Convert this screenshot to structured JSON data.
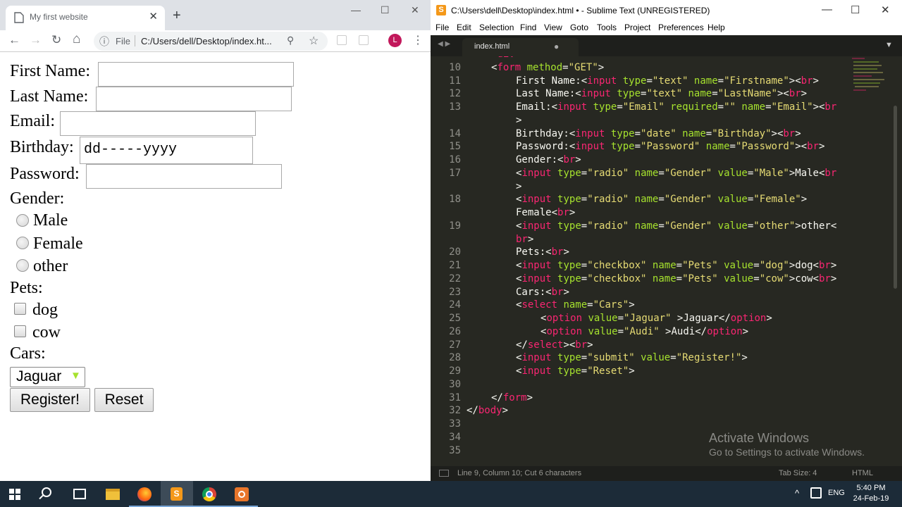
{
  "browser": {
    "tab_title": "My first website",
    "close_glyph": "✕",
    "newtab_glyph": "+",
    "window": {
      "min": "—",
      "max": "☐",
      "close": "✕"
    },
    "nav": {
      "back": "←",
      "forward": "→",
      "reload": "↻",
      "home": "⌂"
    },
    "omnibox": {
      "info": "ⓘ",
      "scheme_label": "File",
      "url": "C:/Users/dell/Desktop/index.ht...",
      "zoom": "⚲",
      "star": "☆"
    },
    "avatar_letter": "L",
    "menu": "⋮"
  },
  "form": {
    "first_name_label": "First Name:",
    "last_name_label": "Last Name:",
    "email_label": "Email:",
    "birthday_label": "Birthday:",
    "birthday_placeholder": "dd-----yyyy",
    "password_label": "Password:",
    "gender_label": "Gender:",
    "gender_options": [
      "Male",
      "Female",
      "other"
    ],
    "pets_label": "Pets:",
    "pet_options": [
      "dog",
      "cow"
    ],
    "cars_label": "Cars:",
    "cars_selected": "Jaguar",
    "cars_arrow": "▼",
    "register_label": "Register!",
    "reset_label": "Reset"
  },
  "sublime": {
    "title": "C:\\Users\\dell\\Desktop\\index.html • - Sublime Text (UNREGISTERED)",
    "icon_letter": "S",
    "window": {
      "min": "—",
      "max": "☐",
      "close": "✕"
    },
    "menu": [
      "File",
      "Edit",
      "Selection",
      "Find",
      "View",
      "Goto",
      "Tools",
      "Project",
      "Preferences",
      "Help"
    ],
    "tab_arrows": "◀ ▶",
    "tab_name": "index.html",
    "tab_dot": "●",
    "tab_dropdown": "▼",
    "lines": [
      {
        "n": "",
        "indent": 1,
        "parts": [
          [
            "<",
            ""
          ],
          [
            "div",
            "t"
          ],
          [
            ">",
            ""
          ]
        ]
      },
      {
        "n": "10",
        "indent": 1,
        "parts": [
          [
            "<",
            ""
          ],
          [
            "form",
            "t"
          ],
          [
            " ",
            ""
          ],
          [
            "method",
            "a"
          ],
          [
            "=",
            ""
          ],
          [
            "\"GET\"",
            "s"
          ],
          [
            ">",
            ""
          ]
        ]
      },
      {
        "n": "11",
        "indent": 2,
        "parts": [
          [
            "First Name:<",
            ""
          ],
          [
            "input",
            "t"
          ],
          [
            " ",
            ""
          ],
          [
            "type",
            "a"
          ],
          [
            "=",
            ""
          ],
          [
            "\"text\"",
            "s"
          ],
          [
            " ",
            ""
          ],
          [
            "name",
            "a"
          ],
          [
            "=",
            ""
          ],
          [
            "\"Firstname\"",
            "s"
          ],
          [
            "><",
            ""
          ],
          [
            "br",
            "t"
          ],
          [
            ">",
            ""
          ]
        ]
      },
      {
        "n": "12",
        "indent": 2,
        "parts": [
          [
            "Last Name:<",
            ""
          ],
          [
            "input",
            "t"
          ],
          [
            " ",
            ""
          ],
          [
            "type",
            "a"
          ],
          [
            "=",
            ""
          ],
          [
            "\"text\"",
            "s"
          ],
          [
            " ",
            ""
          ],
          [
            "name",
            "a"
          ],
          [
            "=",
            ""
          ],
          [
            "\"LastName\"",
            "s"
          ],
          [
            "><",
            ""
          ],
          [
            "br",
            "t"
          ],
          [
            ">",
            ""
          ]
        ]
      },
      {
        "n": "13",
        "indent": 2,
        "parts": [
          [
            "Email:<",
            ""
          ],
          [
            "input",
            "t"
          ],
          [
            " ",
            ""
          ],
          [
            "type",
            "a"
          ],
          [
            "=",
            ""
          ],
          [
            "\"Email\"",
            "s"
          ],
          [
            " ",
            ""
          ],
          [
            "required",
            "a"
          ],
          [
            "=",
            ""
          ],
          [
            "\"\"",
            "s"
          ],
          [
            " ",
            ""
          ],
          [
            "name",
            "a"
          ],
          [
            "=",
            ""
          ],
          [
            "\"Email\"",
            "s"
          ],
          [
            "><",
            ""
          ],
          [
            "br",
            "t"
          ]
        ]
      },
      {
        "n": "",
        "indent": 2,
        "parts": [
          [
            ">",
            ""
          ]
        ]
      },
      {
        "n": "14",
        "indent": 2,
        "parts": [
          [
            "Birthday:<",
            ""
          ],
          [
            "input",
            "t"
          ],
          [
            " ",
            ""
          ],
          [
            "type",
            "a"
          ],
          [
            "=",
            ""
          ],
          [
            "\"date\"",
            "s"
          ],
          [
            " ",
            ""
          ],
          [
            "name",
            "a"
          ],
          [
            "=",
            ""
          ],
          [
            "\"Birthday\"",
            "s"
          ],
          [
            "><",
            ""
          ],
          [
            "br",
            "t"
          ],
          [
            ">",
            ""
          ]
        ]
      },
      {
        "n": "15",
        "indent": 2,
        "parts": [
          [
            "Password:<",
            ""
          ],
          [
            "input",
            "t"
          ],
          [
            " ",
            ""
          ],
          [
            "type",
            "a"
          ],
          [
            "=",
            ""
          ],
          [
            "\"Password\"",
            "s"
          ],
          [
            " ",
            ""
          ],
          [
            "name",
            "a"
          ],
          [
            "=",
            ""
          ],
          [
            "\"Password\"",
            "s"
          ],
          [
            "><",
            ""
          ],
          [
            "br",
            "t"
          ],
          [
            ">",
            ""
          ]
        ]
      },
      {
        "n": "16",
        "indent": 2,
        "parts": [
          [
            "Gender:<",
            ""
          ],
          [
            "br",
            "t"
          ],
          [
            ">",
            ""
          ]
        ]
      },
      {
        "n": "17",
        "indent": 2,
        "parts": [
          [
            "<",
            ""
          ],
          [
            "input",
            "t"
          ],
          [
            " ",
            ""
          ],
          [
            "type",
            "a"
          ],
          [
            "=",
            ""
          ],
          [
            "\"radio\"",
            "s"
          ],
          [
            " ",
            ""
          ],
          [
            "name",
            "a"
          ],
          [
            "=",
            ""
          ],
          [
            "\"Gender\"",
            "s"
          ],
          [
            " ",
            ""
          ],
          [
            "value",
            "a"
          ],
          [
            "=",
            ""
          ],
          [
            "\"Male\"",
            "s"
          ],
          [
            ">Male<",
            ""
          ],
          [
            "br",
            "t"
          ]
        ]
      },
      {
        "n": "",
        "indent": 2,
        "parts": [
          [
            ">",
            ""
          ]
        ]
      },
      {
        "n": "18",
        "indent": 2,
        "parts": [
          [
            "<",
            ""
          ],
          [
            "input",
            "t"
          ],
          [
            " ",
            ""
          ],
          [
            "type",
            "a"
          ],
          [
            "=",
            ""
          ],
          [
            "\"radio\"",
            "s"
          ],
          [
            " ",
            ""
          ],
          [
            "name",
            "a"
          ],
          [
            "=",
            ""
          ],
          [
            "\"Gender\"",
            "s"
          ],
          [
            " ",
            ""
          ],
          [
            "value",
            "a"
          ],
          [
            "=",
            ""
          ],
          [
            "\"Female\"",
            "s"
          ],
          [
            ">",
            ""
          ]
        ]
      },
      {
        "n": "",
        "indent": 2,
        "parts": [
          [
            "Female<",
            ""
          ],
          [
            "br",
            "t"
          ],
          [
            ">",
            ""
          ]
        ]
      },
      {
        "n": "19",
        "indent": 2,
        "parts": [
          [
            "<",
            ""
          ],
          [
            "input",
            "t"
          ],
          [
            " ",
            ""
          ],
          [
            "type",
            "a"
          ],
          [
            "=",
            ""
          ],
          [
            "\"radio\"",
            "s"
          ],
          [
            " ",
            ""
          ],
          [
            "name",
            "a"
          ],
          [
            "=",
            ""
          ],
          [
            "\"Gender\"",
            "s"
          ],
          [
            " ",
            ""
          ],
          [
            "value",
            "a"
          ],
          [
            "=",
            ""
          ],
          [
            "\"other\"",
            "s"
          ],
          [
            ">other<",
            ""
          ]
        ]
      },
      {
        "n": "",
        "indent": 2,
        "parts": [
          [
            "br",
            "t"
          ],
          [
            ">",
            ""
          ]
        ]
      },
      {
        "n": "20",
        "indent": 2,
        "parts": [
          [
            "Pets:<",
            ""
          ],
          [
            "br",
            "t"
          ],
          [
            ">",
            ""
          ]
        ]
      },
      {
        "n": "21",
        "indent": 2,
        "parts": [
          [
            "<",
            ""
          ],
          [
            "input",
            "t"
          ],
          [
            " ",
            ""
          ],
          [
            "type",
            "a"
          ],
          [
            "=",
            ""
          ],
          [
            "\"checkbox\"",
            "s"
          ],
          [
            " ",
            ""
          ],
          [
            "name",
            "a"
          ],
          [
            "=",
            ""
          ],
          [
            "\"Pets\"",
            "s"
          ],
          [
            " ",
            ""
          ],
          [
            "value",
            "a"
          ],
          [
            "=",
            ""
          ],
          [
            "\"dog\"",
            "s"
          ],
          [
            ">dog<",
            ""
          ],
          [
            "br",
            "t"
          ],
          [
            ">",
            ""
          ]
        ]
      },
      {
        "n": "22",
        "indent": 2,
        "parts": [
          [
            "<",
            ""
          ],
          [
            "input",
            "t"
          ],
          [
            " ",
            ""
          ],
          [
            "type",
            "a"
          ],
          [
            "=",
            ""
          ],
          [
            "\"checkbox\"",
            "s"
          ],
          [
            " ",
            ""
          ],
          [
            "name",
            "a"
          ],
          [
            "=",
            ""
          ],
          [
            "\"Pets\"",
            "s"
          ],
          [
            " ",
            ""
          ],
          [
            "value",
            "a"
          ],
          [
            "=",
            ""
          ],
          [
            "\"cow\"",
            "s"
          ],
          [
            ">cow<",
            ""
          ],
          [
            "br",
            "t"
          ],
          [
            ">",
            ""
          ]
        ]
      },
      {
        "n": "23",
        "indent": 2,
        "parts": [
          [
            "Cars:<",
            ""
          ],
          [
            "br",
            "t"
          ],
          [
            ">",
            ""
          ]
        ]
      },
      {
        "n": "24",
        "indent": 2,
        "parts": [
          [
            "<",
            ""
          ],
          [
            "select",
            "t"
          ],
          [
            " ",
            ""
          ],
          [
            "name",
            "a"
          ],
          [
            "=",
            ""
          ],
          [
            "\"Cars\"",
            "s"
          ],
          [
            ">",
            ""
          ]
        ]
      },
      {
        "n": "25",
        "indent": 3,
        "parts": [
          [
            "<",
            ""
          ],
          [
            "option",
            "t"
          ],
          [
            " ",
            ""
          ],
          [
            "value",
            "a"
          ],
          [
            "=",
            ""
          ],
          [
            "\"Jaguar\"",
            "s"
          ],
          [
            " >Jaguar</",
            ""
          ],
          [
            "option",
            "t"
          ],
          [
            ">",
            ""
          ]
        ]
      },
      {
        "n": "26",
        "indent": 3,
        "parts": [
          [
            "<",
            ""
          ],
          [
            "option",
            "t"
          ],
          [
            " ",
            ""
          ],
          [
            "value",
            "a"
          ],
          [
            "=",
            ""
          ],
          [
            "\"Audi\"",
            "s"
          ],
          [
            " >Audi</",
            ""
          ],
          [
            "option",
            "t"
          ],
          [
            ">",
            ""
          ]
        ]
      },
      {
        "n": "27",
        "indent": 2,
        "parts": [
          [
            "</",
            ""
          ],
          [
            "select",
            "t"
          ],
          [
            "><",
            ""
          ],
          [
            "br",
            "t"
          ],
          [
            ">",
            ""
          ]
        ]
      },
      {
        "n": "28",
        "indent": 2,
        "parts": [
          [
            "<",
            ""
          ],
          [
            "input",
            "t"
          ],
          [
            " ",
            ""
          ],
          [
            "type",
            "a"
          ],
          [
            "=",
            ""
          ],
          [
            "\"submit\"",
            "s"
          ],
          [
            " ",
            ""
          ],
          [
            "value",
            "a"
          ],
          [
            "=",
            ""
          ],
          [
            "\"Register!\"",
            "s"
          ],
          [
            ">",
            ""
          ]
        ]
      },
      {
        "n": "29",
        "indent": 2,
        "parts": [
          [
            "<",
            ""
          ],
          [
            "input",
            "t"
          ],
          [
            " ",
            ""
          ],
          [
            "type",
            "a"
          ],
          [
            "=",
            ""
          ],
          [
            "\"Reset\"",
            "s"
          ],
          [
            ">",
            ""
          ]
        ]
      },
      {
        "n": "30",
        "indent": 0,
        "parts": []
      },
      {
        "n": "31",
        "indent": 1,
        "parts": [
          [
            "</",
            ""
          ],
          [
            "form",
            "t"
          ],
          [
            ">",
            ""
          ]
        ]
      },
      {
        "n": "32",
        "indent": 0,
        "parts": [
          [
            "</",
            ""
          ],
          [
            "body",
            "t"
          ],
          [
            ">",
            ""
          ]
        ]
      },
      {
        "n": "33",
        "indent": 0,
        "parts": []
      },
      {
        "n": "34",
        "indent": 0,
        "parts": []
      },
      {
        "n": "35",
        "indent": 0,
        "parts": []
      }
    ],
    "watermark_title": "Activate Windows",
    "watermark_sub": "Go to Settings to activate Windows.",
    "status_msg": "Line 9, Column 10; Cut 6 characters",
    "status_tab": "Tab Size: 4",
    "status_syntax": "HTML",
    "colors": {
      "bg": "#272822",
      "tag": "#f92672",
      "attr": "#a6e22e",
      "string": "#e6db74",
      "text": "#f8f8f2"
    }
  },
  "taskbar": {
    "apps": [
      "start",
      "search",
      "task-view",
      "file-explorer",
      "firefox",
      "sublime-text",
      "chrome",
      "app"
    ],
    "tray_chevron": "^",
    "language": "ENG",
    "time": "5:40 PM",
    "date": "24-Feb-19"
  }
}
